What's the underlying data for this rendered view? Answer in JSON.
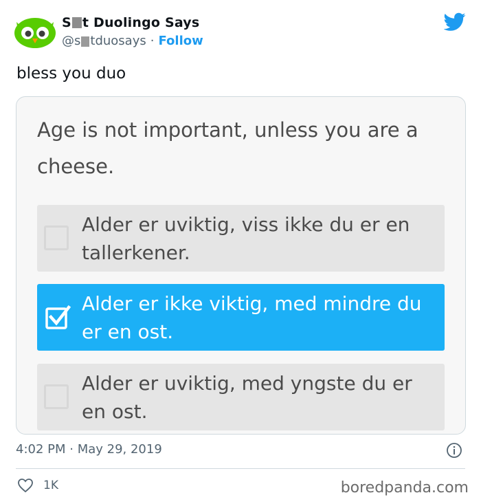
{
  "tweet": {
    "display_name_prefix": "S",
    "display_name_suffix": "t Duolingo Says",
    "handle_prefix": "@s",
    "handle_suffix": "tduosays",
    "follow_label": "Follow",
    "text": "bless you duo",
    "timestamp": "4:02 PM · May 29, 2019",
    "like_count": "1K"
  },
  "card": {
    "prompt": "Age is not important, unless you are a cheese.",
    "options": [
      {
        "text": "Alder er uviktig, viss ikke du er en tallerkener.",
        "checked": false
      },
      {
        "text": "Alder er ikke viktig, med mindre du er en ost.",
        "checked": true
      },
      {
        "text": "Alder er uviktig, med yngste du er en ost.",
        "checked": false
      }
    ]
  },
  "watermark": "boredpanda.com",
  "colors": {
    "twitter_blue": "#1d9bf0",
    "duolingo_green": "#58cc02",
    "selected_option": "#1cb0f6",
    "option_bg": "#e5e5e5"
  },
  "icons": [
    "owl-avatar",
    "twitter-bird-icon",
    "checkbox-icon",
    "checkmark-icon",
    "info-icon",
    "heart-icon"
  ]
}
